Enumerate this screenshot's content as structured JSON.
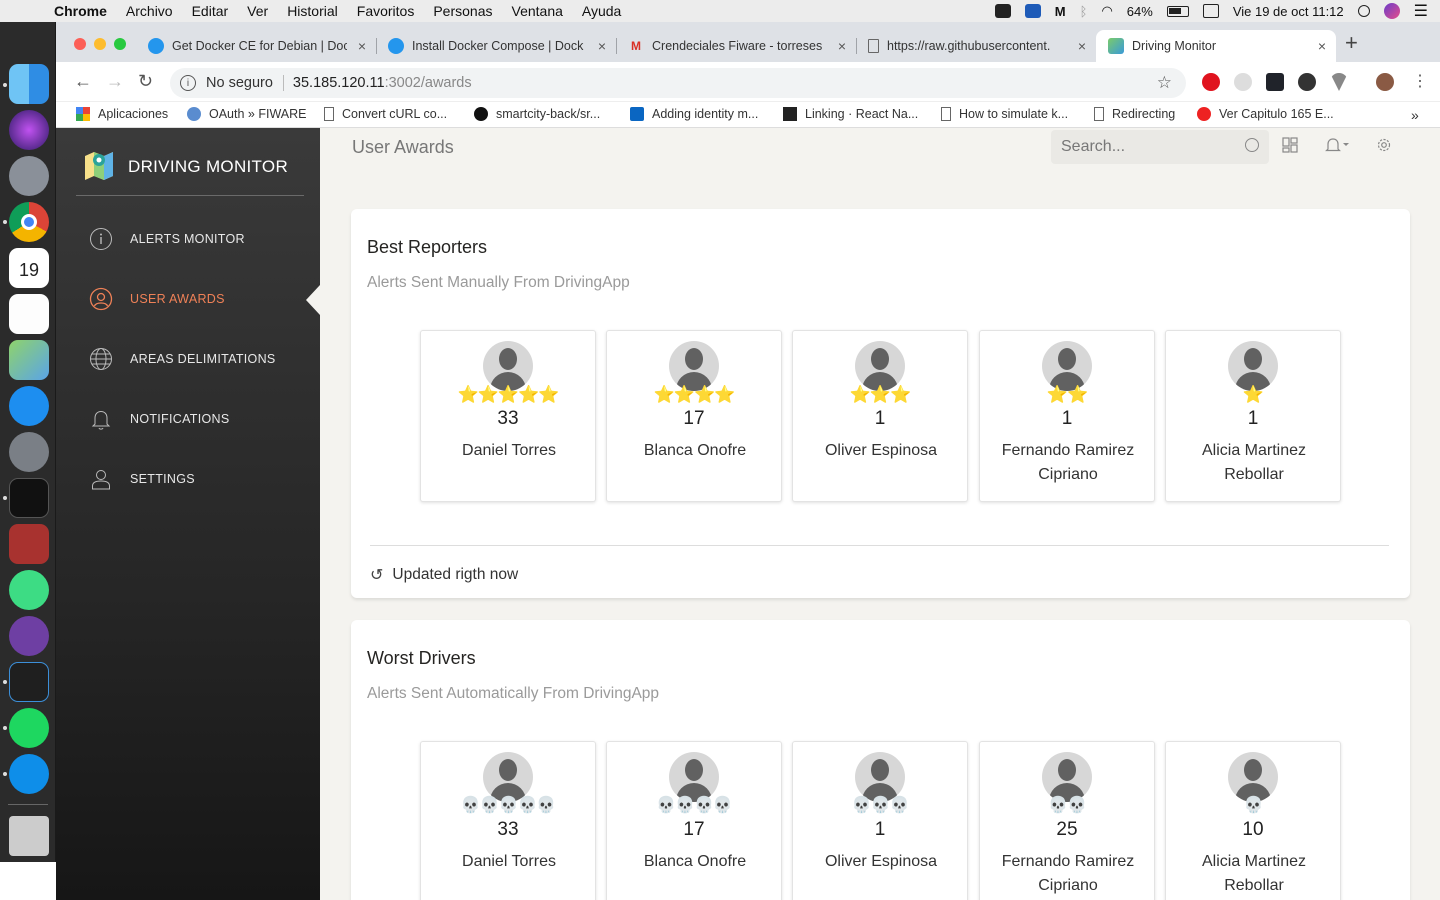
{
  "menubar": {
    "items": [
      "Chrome",
      "Archivo",
      "Editar",
      "Ver",
      "Historial",
      "Favoritos",
      "Personas",
      "Ventana",
      "Ayuda"
    ],
    "battery": "64%",
    "datetime": "Vie 19 de oct  11:12"
  },
  "browser": {
    "tabs": [
      {
        "label": "Get Docker CE for Debian | Doc",
        "icon": "docker-icon"
      },
      {
        "label": "Install Docker Compose | Dock",
        "icon": "docker-icon"
      },
      {
        "label": "Crendeciales Fiware - torreses",
        "icon": "gmail-icon"
      },
      {
        "label": "https://raw.githubusercontent.",
        "icon": "document-icon"
      },
      {
        "label": "Driving Monitor",
        "icon": "map-icon"
      }
    ],
    "omnibox": {
      "security": "No seguro",
      "host": "35.185.120.11",
      "path": ":3002/awards"
    },
    "bookmarks": [
      "Aplicaciones",
      "OAuth » FIWARE",
      "Convert cURL co...",
      "smartcity-back/sr...",
      "Adding identity m...",
      "Linking · React Na...",
      "How to simulate k...",
      "Redirecting",
      "Ver Capitulo 165 E..."
    ],
    "bookmarks_more": "»"
  },
  "sidebar": {
    "brand": "DRIVING MONITOR",
    "items": [
      {
        "label": "ALERTS MONITOR",
        "icon": "info-icon"
      },
      {
        "label": "USER AWARDS",
        "icon": "user-circle-icon"
      },
      {
        "label": "AREAS DELIMITATIONS",
        "icon": "globe-icon"
      },
      {
        "label": "NOTIFICATIONS",
        "icon": "bell-icon"
      },
      {
        "label": "SETTINGS",
        "icon": "person-icon"
      }
    ],
    "active_color": "#ef8157"
  },
  "topbar": {
    "title": "User Awards",
    "search_placeholder": "Search..."
  },
  "best": {
    "title": "Best Reporters",
    "subtitle": "Alerts Sent Manually From DrivingApp",
    "users": [
      {
        "name": "Daniel Torres",
        "count": "33",
        "stars": "⭐⭐⭐⭐⭐"
      },
      {
        "name": "Blanca Onofre",
        "count": "17",
        "stars": "⭐⭐⭐⭐"
      },
      {
        "name": "Oliver Espinosa",
        "count": "1",
        "stars": "⭐⭐⭐"
      },
      {
        "name": "Fernando Ramirez Cipriano",
        "count": "1",
        "stars": "⭐⭐"
      },
      {
        "name": "Alicia Martinez Rebollar",
        "count": "1",
        "stars": "⭐"
      }
    ],
    "footer": "Updated rigth now"
  },
  "worst": {
    "title": "Worst Drivers",
    "subtitle": "Alerts Sent Automatically From DrivingApp",
    "users": [
      {
        "name": "Daniel Torres",
        "count": "33",
        "skulls": "💀💀💀💀💀"
      },
      {
        "name": "Blanca Onofre",
        "count": "17",
        "skulls": "💀💀💀💀"
      },
      {
        "name": "Oliver Espinosa",
        "count": "1",
        "skulls": "💀💀💀"
      },
      {
        "name": "Fernando Ramirez Cipriano",
        "count": "25",
        "skulls": "💀💀"
      },
      {
        "name": "Alicia Martinez Rebollar",
        "count": "10",
        "skulls": "💀"
      }
    ]
  }
}
